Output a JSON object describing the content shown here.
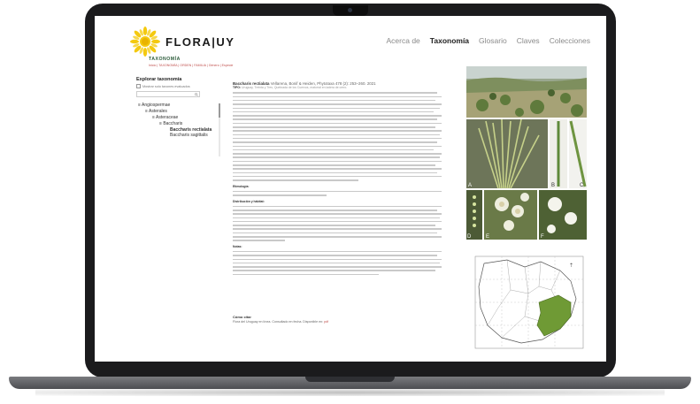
{
  "header": {
    "brand": "FLORA|UY",
    "nav": [
      "Acerca de",
      "Taxonomía",
      "Glosario",
      "Claves",
      "Colecciones"
    ],
    "nav_active": "Taxonomía"
  },
  "page": {
    "section": "TAXONOMÍA",
    "breadcrumb": "Inicio  |  TAXONOMÍA  |  ORDEN  |  FAMILIA  |  Género  |  Especie"
  },
  "sidebar": {
    "title": "Explorar taxonomía",
    "checkbox_label": "Mostrar solo taxones evaluados",
    "tree": [
      {
        "label": "Angiospermae",
        "level": 0
      },
      {
        "label": "Asterales",
        "level": 1
      },
      {
        "label": "Asteraceae",
        "level": 2
      },
      {
        "label": "Baccharis",
        "level": 3
      },
      {
        "label": "Baccharis rectialata",
        "level": 4
      },
      {
        "label": "Baccharis sagittalis",
        "level": 4
      }
    ]
  },
  "article": {
    "title": "Baccharis rectialata",
    "authority": " Vellarena, Bonif & Heiden, Phytotaxa 478 (2): 253–260. 2021",
    "tipo_label": "TIPO:",
    "tipo_text": " Uruguay, Treinta y Tres, Quebrada de los Cuervos, matorral en ladera de cerro.",
    "etimologia_label": "Etimología:",
    "distribucion_label": "Distribución y hábitat:",
    "notas_label": "Notas:"
  },
  "citation": {
    "title": "Cómo citar",
    "text": "Flora del Uruguay en línea. Consultado en fecha. Disponible en:",
    "link": "pdf"
  },
  "colors": {
    "accent": "#c0504d",
    "section": "#2b5b3a",
    "map_fill": "#6f9a35",
    "sun": "#f4c90f"
  },
  "icons": [
    "sun-logo-icon",
    "checkbox-icon",
    "search-icon",
    "collapse-icon",
    "scrollbar-thumb"
  ]
}
